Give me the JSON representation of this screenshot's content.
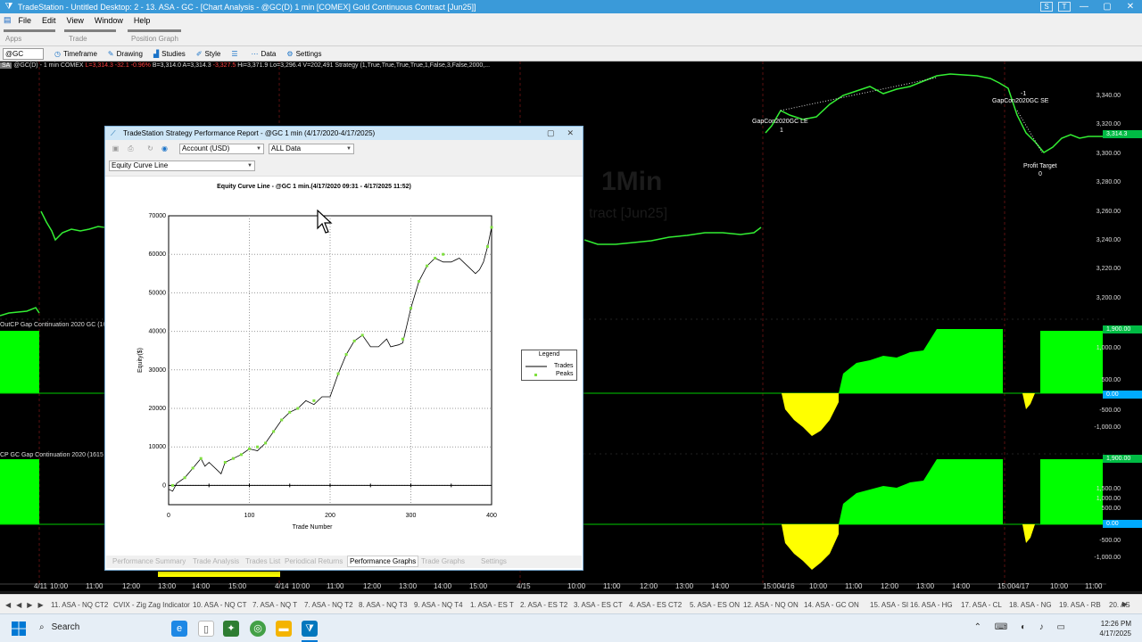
{
  "titlebar": {
    "text": "TradeStation  - Untitled Desktop: 2 - 13. ASA - GC - [Chart Analysis - @GC(D) 1 min [COMEX] Gold Continuous Contract [Jun25]]",
    "s_badge": "S",
    "ts_badge": "T"
  },
  "menu": [
    "File",
    "Edit",
    "View",
    "Window",
    "Help"
  ],
  "ribbon": [
    "Apps",
    "Trade",
    "Position Graph"
  ],
  "toolbar": {
    "symbol": "@GC",
    "buttons": [
      "Timeframe",
      "Drawing",
      "Studies",
      "Style",
      "Data",
      "Settings"
    ]
  },
  "chart": {
    "symbol_badge": "SA",
    "info_prefix": "@GC(D) - 1 min  COMEX",
    "info_last": "L=3,314.3  -32.1  -0.96%",
    "info_rest": "B=3,314.0  A=3,314.3",
    "info_chg": "-3,327.5",
    "info_tail": "Hi=3,371.9  Lo=3,296.4  V=202,491  Strategy (1,True,True,True,True,1,False,3,False,2000,...",
    "watermark": "1Min",
    "watermark2": "tract [Jun25]",
    "price_labels": [
      "3,340.00",
      "3,320.00",
      "3,300.00",
      "3,280.00",
      "3,260.00",
      "3,240.00",
      "3,220.00",
      "3,200.00"
    ],
    "price_current": "3,314.3",
    "ind1_label": "OutCP Gap Continuation 2020 GC (16",
    "ind2_label": "CP GC Gap Continuation 2020 (1615",
    "ind_labels": [
      "1,900.00",
      "1,000.00",
      "500.00",
      "0.00",
      "-500.00",
      "-1,000.00"
    ],
    "ind2_labels": [
      "1,900.00",
      "1,500.00",
      "1,000.00",
      "500.00",
      "0.00",
      "-500.00",
      "-1,000.00"
    ],
    "annotations": {
      "le": "GapCon2020GC LE",
      "le_qty": "1",
      "se": "GapCon2020GC SE",
      "se_qty": "-1",
      "pt": "Profit Target",
      "pt_qty": "0"
    },
    "time_labels": [
      "4/11",
      "10:00",
      "11:00",
      "12:00",
      "13:00",
      "14:00",
      "15:00",
      "4/14",
      "10:00",
      "11:00",
      "12:00",
      "13:00",
      "14:00",
      "15:00",
      "4/15",
      "10:00",
      "11:00",
      "12:00",
      "13:00",
      "14:00",
      "15:00",
      "4/16",
      "10:00",
      "11:00",
      "12:00",
      "13:00",
      "14:00",
      "15:00",
      "4/17",
      "10:00",
      "11:00",
      "12:00"
    ]
  },
  "report": {
    "title": "TradeStation Strategy Performance Report - @GC 1 min (4/17/2020-4/17/2025)",
    "account": "Account (USD)",
    "data_range": "ALL Data",
    "view": "Equity Curve Line",
    "graph_title": "Equity Curve Line - @GC 1 min.(4/17/2020 09:31 - 4/17/2025 11:52)",
    "legend_title": "Legend",
    "legend_trades": "Trades",
    "legend_peaks": "Peaks",
    "tabs": [
      "Performance Summary",
      "Trade Analysis",
      "Trades List",
      "Periodical Returns",
      "Performance Graphs",
      "Trade Graphs",
      "Settings"
    ],
    "active_tab": "Performance Graphs"
  },
  "chart_data": {
    "type": "line",
    "title": "Equity Curve Line - @GC 1 min.(4/17/2020 09:31 - 4/17/2025 11:52)",
    "xlabel": "Trade Number",
    "ylabel": "Equity($)",
    "xlim": [
      0,
      400
    ],
    "ylim": [
      -5000,
      70000
    ],
    "xticks": [
      0,
      100,
      200,
      300,
      400
    ],
    "yticks": [
      0,
      10000,
      20000,
      30000,
      40000,
      50000,
      60000,
      70000
    ],
    "grid": true,
    "legend": "right",
    "series": [
      {
        "name": "Trades",
        "color": "#000000",
        "x": [
          0,
          5,
          10,
          20,
          30,
          40,
          45,
          50,
          60,
          65,
          70,
          80,
          90,
          100,
          110,
          120,
          130,
          140,
          150,
          160,
          170,
          180,
          190,
          200,
          210,
          220,
          230,
          240,
          250,
          260,
          270,
          275,
          285,
          290,
          300,
          310,
          320,
          330,
          340,
          350,
          360,
          370,
          380,
          385,
          390,
          395,
          400
        ],
        "y": [
          -1000,
          -1500,
          500,
          2000,
          4500,
          7000,
          5000,
          6000,
          4000,
          3000,
          6000,
          7000,
          8000,
          9500,
          9000,
          11000,
          14000,
          17000,
          19000,
          20000,
          22000,
          21000,
          23000,
          23000,
          29000,
          34000,
          37500,
          39000,
          36000,
          36000,
          38000,
          36000,
          36500,
          37000,
          46000,
          53000,
          57000,
          59000,
          58000,
          58000,
          59000,
          57000,
          55000,
          56000,
          58000,
          62000,
          67000
        ]
      },
      {
        "name": "Peaks",
        "color": "#80e040",
        "x": [
          5,
          20,
          30,
          40,
          70,
          80,
          90,
          100,
          110,
          120,
          130,
          140,
          150,
          160,
          180,
          210,
          220,
          230,
          240,
          290,
          300,
          310,
          320,
          330,
          340,
          395,
          400
        ],
        "y": [
          0,
          2000,
          4500,
          7000,
          6000,
          7000,
          8000,
          9500,
          10000,
          11000,
          14000,
          17000,
          19000,
          20000,
          22000,
          29000,
          34000,
          37500,
          39000,
          38000,
          46000,
          53000,
          57000,
          59000,
          60000,
          62000,
          67000
        ]
      }
    ]
  },
  "tabs_strip": [
    "11. ASA - NQ CT2",
    "CVIX - Zig Zag Indicator",
    "10. ASA - NQ CT",
    "7. ASA - NQ T",
    "7. ASA - NQ T2",
    "8. ASA - NQ T3",
    "9. ASA - NQ T4",
    "1. ASA - ES T",
    "2. ASA - ES T2",
    "3. ASA - ES CT",
    "4. ASA - ES CT2",
    "5. ASA - ES ON",
    "12. ASA - NQ ON",
    "14. ASA - GC ON",
    "15. ASA - SI",
    "16. ASA - HG",
    "17. ASA - CL",
    "18. ASA - NG",
    "19. ASA - RB",
    "20. AS"
  ],
  "taskbar": {
    "search": "Search",
    "time": "12:26 PM",
    "date": "4/17/2025"
  }
}
